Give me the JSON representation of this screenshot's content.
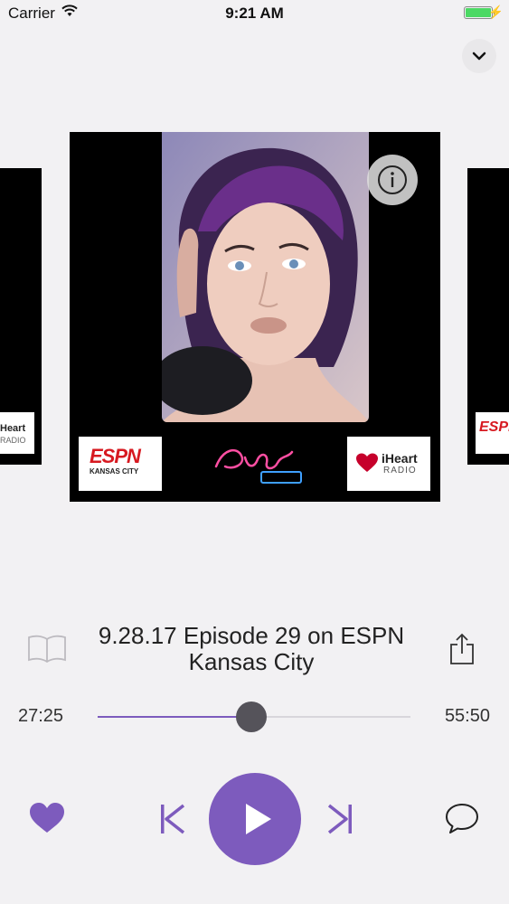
{
  "status_bar": {
    "carrier": "Carrier",
    "time": "9:21 AM",
    "battery_level": 1.0
  },
  "artwork": {
    "left_logo": {
      "brand": "ESPN",
      "subtitle": "KANSAS CITY"
    },
    "right_logo": {
      "brand": "iHeart",
      "subtitle": "RADIO"
    },
    "left_card_logo": {
      "brand": "Heart",
      "subtitle": "RADIO"
    },
    "right_card_logo": {
      "brand": "ESPN"
    }
  },
  "episode": {
    "title": "9.28.17 Episode 29 on ESPN Kansas City"
  },
  "playback": {
    "elapsed": "27:25",
    "duration": "55:50",
    "progress": 0.49
  },
  "colors": {
    "accent": "#7d5bbd",
    "background": "#f2f1f3",
    "thumb": "#55535a"
  },
  "icons": {
    "collapse": "chevron-down-icon",
    "info": "info-icon",
    "book": "book-icon",
    "share": "share-icon",
    "favorite": "heart-icon",
    "previous": "skip-back-icon",
    "play": "play-icon",
    "next": "skip-forward-icon",
    "comment": "comment-icon"
  }
}
